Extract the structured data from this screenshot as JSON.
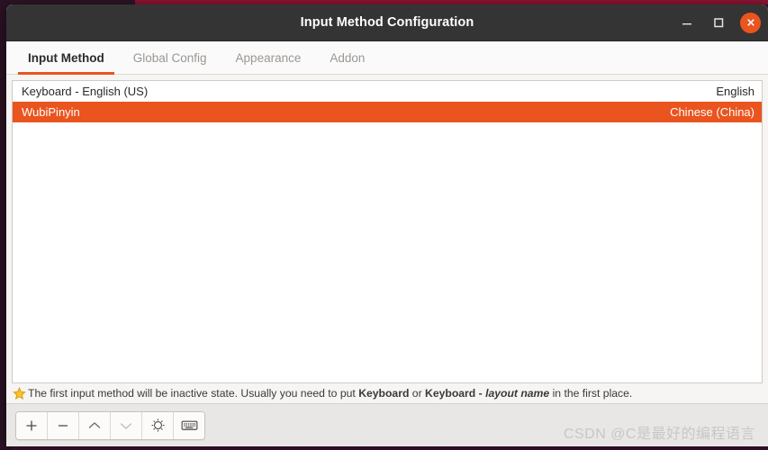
{
  "window": {
    "title": "Input Method Configuration",
    "controls": {
      "minimize_label": "Minimize",
      "maximize_label": "Maximize",
      "close_label": "Close"
    }
  },
  "tabs": [
    {
      "label": "Input Method",
      "active": true
    },
    {
      "label": "Global Config",
      "active": false
    },
    {
      "label": "Appearance",
      "active": false
    },
    {
      "label": "Addon",
      "active": false
    }
  ],
  "input_methods": {
    "rows": [
      {
        "name": "Keyboard - English (US)",
        "language": "English",
        "selected": false
      },
      {
        "name": "WubiPinyin",
        "language": "Chinese (China)",
        "selected": true
      }
    ]
  },
  "hint": {
    "text_part1": "The first input method will be inactive state. Usually you need to put ",
    "bold1": "Keyboard",
    "text_part2": " or ",
    "bold2": "Keyboard - ",
    "italic1": "layout name",
    "text_part3": " in the first place.",
    "icon": "star-icon"
  },
  "toolbar": {
    "buttons": [
      {
        "name": "add-button",
        "glyph": "plus",
        "enabled": true
      },
      {
        "name": "remove-button",
        "glyph": "minus",
        "enabled": true
      },
      {
        "name": "move-up-button",
        "glyph": "chevron-up",
        "enabled": true
      },
      {
        "name": "move-down-button",
        "glyph": "chevron-down",
        "enabled": false
      },
      {
        "name": "configure-button",
        "glyph": "gear",
        "enabled": true
      },
      {
        "name": "keyboard-layout-button",
        "glyph": "keyboard",
        "enabled": true
      }
    ]
  },
  "watermark": {
    "text": "CSDN @C是最好的编程语言"
  },
  "colors": {
    "accent": "#e9541f",
    "titlebar": "#343434",
    "toolbar_bg": "#e9e7e5",
    "list_bg": "#ffffff",
    "desktop": "#3a1430"
  }
}
